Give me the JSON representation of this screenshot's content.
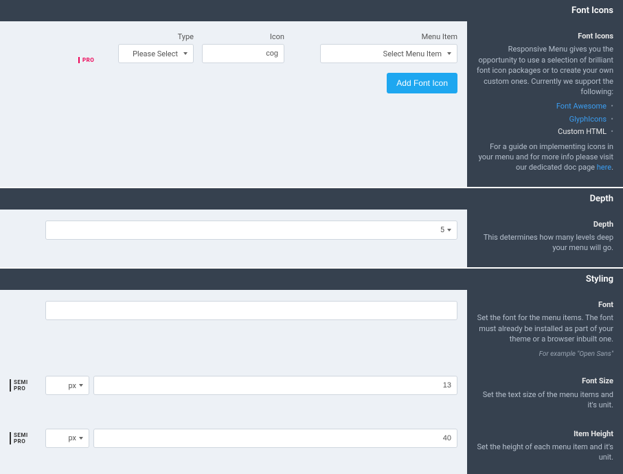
{
  "sections": {
    "font_icons": {
      "header": "Font Icons",
      "info_title": "Font Icons",
      "info_desc": "Responsive Menu gives you the opportunity to use a selection of brilliant font icon packages or to create your own custom ones. Currently we support the following:",
      "link_fa": "Font Awesome",
      "link_gl": "GlyphIcons",
      "link_custom": "Custom HTML",
      "guide_text": "For a guide on implementing icons in your menu and for more info please visit our dedicated doc page ",
      "guide_link": "here",
      "badge": "PRO",
      "type_label": "Type",
      "type_value": "Please Select",
      "icon_label": "Icon",
      "icon_value": "cog",
      "menu_label": "Menu Item",
      "menu_value": "Select Menu Item",
      "add_btn": "Add Font Icon"
    },
    "depth": {
      "header": "Depth",
      "info_title": "Depth",
      "info_desc": "This determines how many levels deep your menu will go.",
      "value": "5"
    },
    "styling": {
      "header": "Styling",
      "font": {
        "info_title": "Font",
        "info_desc": "Set the font for the menu items. The font must already be installed as part of your theme or a browser inbuilt one.",
        "info_hint": "For example \"Open Sans\"",
        "value": ""
      },
      "font_size": {
        "info_title": "Font Size",
        "info_desc": "Set the text size of the menu items and it's unit.",
        "badge": "SEMI PRO",
        "unit": "px",
        "value": "13"
      },
      "item_height": {
        "info_title": "Item Height",
        "info_desc": "Set the height of each menu item and it's unit.",
        "badge": "SEMI PRO",
        "unit": "px",
        "value": "40"
      }
    }
  }
}
